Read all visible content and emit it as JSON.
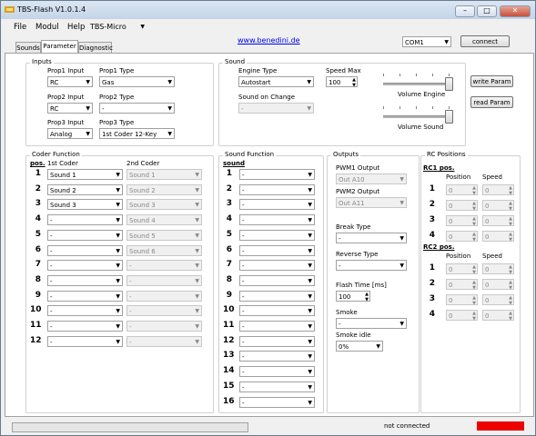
{
  "window": {
    "title": "TBS-Flash V1.0.1.4",
    "min": "–",
    "max": "□",
    "close": "✕"
  },
  "menu": {
    "file": "File",
    "modul": "Modul",
    "help": "Help",
    "device": "TBS-Micro"
  },
  "header": {
    "website": "www.benedini.de",
    "port": "COM1",
    "connect": "connect"
  },
  "tabs": [
    "Sounds",
    "Parameter",
    "Diagnostic"
  ],
  "inputs": {
    "title": "Inputs",
    "prop1_input_label": "Prop1 Input",
    "prop1_input": "RC",
    "prop1_type_label": "Prop1 Type",
    "prop1_type": "Gas",
    "prop2_input_label": "Prop2 Input",
    "prop2_input": "RC",
    "prop2_type_label": "Prop2 Type",
    "prop2_type": "-",
    "prop3_input_label": "Prop3 Input",
    "prop3_input": "Analog",
    "prop3_type_label": "Prop3 Type",
    "prop3_type": "1st Coder 12-Key"
  },
  "sound": {
    "title": "Sound",
    "engine_type_label": "Engine Type",
    "engine_type": "Autostart",
    "speed_max_label": "Speed Max",
    "speed_max": "100",
    "sound_on_change_label": "Sound on Change",
    "sound_on_change": "-",
    "volume_engine_label": "Volume Engine",
    "volume_engine": 1.0,
    "volume_sound_label": "Volume Sound",
    "volume_sound": 1.0,
    "write_param": "write Param",
    "read_param": "read Param"
  },
  "coder": {
    "title": "Coder Function",
    "pos_label": "pos.",
    "first_label": "1st Coder",
    "second_label": "2nd Coder",
    "rows": [
      {
        "n": "1",
        "first": "Sound 1",
        "second": "Sound 1"
      },
      {
        "n": "2",
        "first": "Sound 2",
        "second": "Sound 2"
      },
      {
        "n": "3",
        "first": "Sound 3",
        "second": "Sound 3"
      },
      {
        "n": "4",
        "first": "-",
        "second": "Sound 4"
      },
      {
        "n": "5",
        "first": "-",
        "second": "Sound 5"
      },
      {
        "n": "6",
        "first": "-",
        "second": "Sound 6"
      },
      {
        "n": "7",
        "first": "-",
        "second": "-"
      },
      {
        "n": "8",
        "first": "-",
        "second": "-"
      },
      {
        "n": "9",
        "first": "-",
        "second": "-"
      },
      {
        "n": "10",
        "first": "-",
        "second": "-"
      },
      {
        "n": "11",
        "first": "-",
        "second": "-"
      },
      {
        "n": "12",
        "first": "-",
        "second": "-"
      }
    ]
  },
  "sound_function": {
    "title": "Sound Function",
    "sound_label": "sound",
    "rows": [
      {
        "n": "1",
        "v": "-"
      },
      {
        "n": "2",
        "v": "-"
      },
      {
        "n": "3",
        "v": "-"
      },
      {
        "n": "4",
        "v": "-"
      },
      {
        "n": "5",
        "v": "-"
      },
      {
        "n": "6",
        "v": "-"
      },
      {
        "n": "7",
        "v": "-"
      },
      {
        "n": "8",
        "v": "-"
      },
      {
        "n": "9",
        "v": "-"
      },
      {
        "n": "10",
        "v": "-"
      },
      {
        "n": "11",
        "v": "-"
      },
      {
        "n": "12",
        "v": "-"
      },
      {
        "n": "13",
        "v": "-"
      },
      {
        "n": "14",
        "v": "-"
      },
      {
        "n": "15",
        "v": "-"
      },
      {
        "n": "16",
        "v": "-"
      }
    ]
  },
  "outputs": {
    "title": "Outputs",
    "pwm1_label": "PWM1 Output",
    "pwm1": "Out A10",
    "pwm2_label": "PWM2 Output",
    "pwm2": "Out A11",
    "break_label": "Break Type",
    "break": "-",
    "reverse_label": "Reverse Type",
    "reverse": "-",
    "flash_label": "Flash Time [ms]",
    "flash": "100",
    "smoke_label": "Smoke",
    "smoke": "-",
    "smoke_idle_label": "Smoke idle",
    "smoke_idle": "0%"
  },
  "rc": {
    "title": "RC Positions",
    "rc1_label": "RC1 pos.",
    "rc2_label": "RC2 pos.",
    "position_label": "Position",
    "speed_label": "Speed",
    "rc1_rows": [
      {
        "n": "1",
        "p": "0",
        "s": "0"
      },
      {
        "n": "2",
        "p": "0",
        "s": "0"
      },
      {
        "n": "3",
        "p": "0",
        "s": "0"
      },
      {
        "n": "4",
        "p": "0",
        "s": "0"
      }
    ],
    "rc2_rows": [
      {
        "n": "1",
        "p": "0",
        "s": "0"
      },
      {
        "n": "2",
        "p": "0",
        "s": "0"
      },
      {
        "n": "3",
        "p": "0",
        "s": "0"
      },
      {
        "n": "4",
        "p": "0",
        "s": "0"
      }
    ]
  },
  "status": {
    "text": "not connected",
    "indicator_color": "#ee0000"
  }
}
